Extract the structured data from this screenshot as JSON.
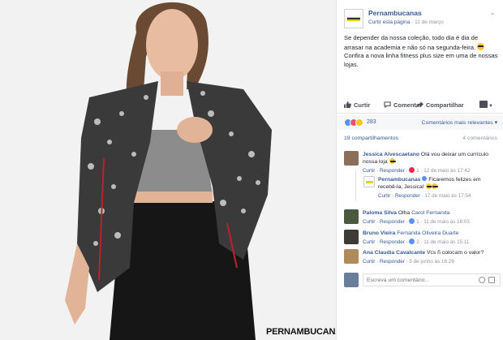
{
  "photo": {
    "brand_watermark": "PERNAMBUCANAS"
  },
  "post": {
    "page_name": "Pernambucanas",
    "follow_label": "Curtir esta página",
    "date": "11 de março",
    "text_line1": "Se depender da nossa coleção, todo dia é dia de arrasar na academia e não só na segunda-feira.",
    "text_line2": "Confira a nova linha fitness plus size em uma de nossas lojas."
  },
  "actions": {
    "like": "Curtir",
    "comment": "Comentar",
    "share": "Compartilhar"
  },
  "reactions": {
    "count": "283",
    "sort_label": "Comentários mais relevantes"
  },
  "counts": {
    "shares": "19 compartilhamentos",
    "comments": "4 comentários"
  },
  "comments": [
    {
      "author": "Jessica Alvescaetano",
      "text": "Olá vou deixar um currículo nossa loja",
      "actions": "Curtir · Responder ·",
      "likes": "1",
      "date": "12 de maio às 17:42"
    },
    {
      "author": "Pernambucanas",
      "text": "Ficaremos felizes em recebê-la, Jessica!",
      "actions": "Curtir · Responder ·",
      "date": "17 de maio às 17:54"
    },
    {
      "author": "Paloma Silva",
      "mention": "Carol Fernanda",
      "text": "Olha",
      "actions": "Curtir · Responder ·",
      "likes": "1",
      "date": "11 de maio às 16:03"
    },
    {
      "author": "Bruno Vieira",
      "mention": "Fernanda Oliveira Duarte",
      "actions": "Curtir · Responder ·",
      "likes": "2",
      "date": "11 de maio às 15:11"
    },
    {
      "author": "Ana Claudia Cavalcante",
      "text": "Vcs ñ colocam o valor?",
      "actions": "Curtir · Responder ·",
      "date": "5 de junho às 16:29"
    }
  ],
  "composer": {
    "placeholder": "Escreva um comentário..."
  },
  "colors": {
    "link": "#365899",
    "meta": "#90949c",
    "brand_yellow": "#e2d600"
  }
}
